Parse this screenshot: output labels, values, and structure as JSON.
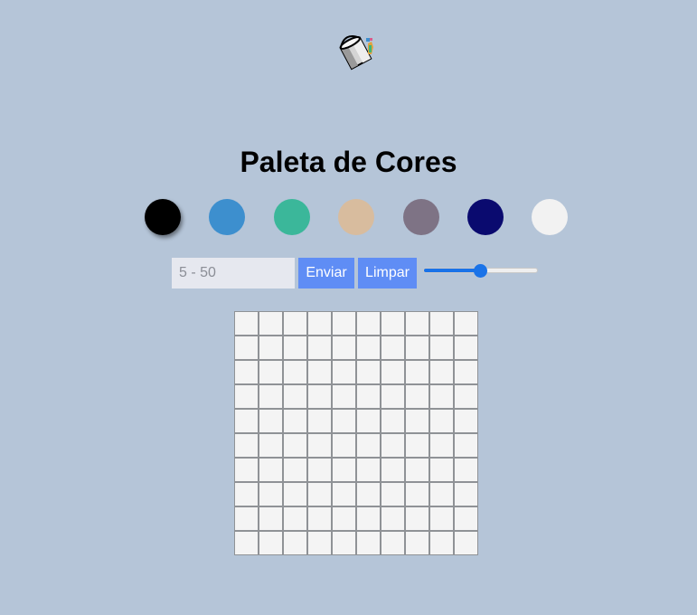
{
  "header": {
    "logo_icon": "paint-bucket-icon",
    "title": "Paleta de Cores"
  },
  "palette": {
    "colors": [
      "#000000",
      "#3d8fce",
      "#3bb79a",
      "#d8bc9e",
      "#7e7385",
      "#0a0a6f",
      "#f2f2f2"
    ],
    "selected_index": 0
  },
  "controls": {
    "size_input": {
      "placeholder": "5 - 50",
      "value": ""
    },
    "send_label": "Enviar",
    "clear_label": "Limpar",
    "slider": {
      "min": 0,
      "max": 100,
      "value": 50
    }
  },
  "board": {
    "rows": 10,
    "cols": 10,
    "pixel_color": "#f4f4f4"
  }
}
